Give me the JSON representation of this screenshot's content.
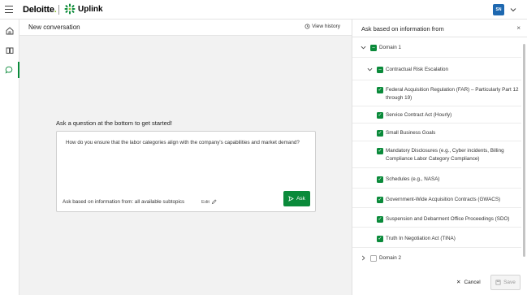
{
  "topbar": {
    "brand": "Deloitte",
    "brand_dot": ".",
    "product": "Uplink",
    "avatar_initials": "SN"
  },
  "rail": {
    "items": [
      {
        "icon": "home-icon"
      },
      {
        "icon": "book-icon"
      },
      {
        "icon": "chat-icon",
        "active": true
      }
    ]
  },
  "main": {
    "title": "New conversation",
    "view_history_label": "View history",
    "empty_prompt": "Ask a question at the bottom to get started!",
    "question": "How do you ensure that the labor categories align with the company's capabilities and market demand?",
    "ask_based_label": "Ask based on information from: all available subtopics",
    "edit_label": "Edit",
    "ask_button_label": "Ask"
  },
  "panel": {
    "title": "Ask based on information from",
    "domain1_label": "Domain 1",
    "subtopic_label": "Contractual Risk Escalation",
    "items": [
      "Federal Acquisition Regulation (FAR) – Particularly Part 12 through 19)",
      "Service Contract Act (Hourly)",
      "Small Business Goals",
      "Mandatory Disclosures (e.g., Cyber incidents, Billing Compliance Labor Category Compliance)",
      "Schedules (e.g., NASA)",
      "Government-Wide Acquisition Contracts (GWACS)",
      "Suspension and Debarment Office Proceedings (SDO)",
      "Truth In Negotiation Act (TINA)"
    ],
    "domain2_label": "Domain 2",
    "cancel_label": "Cancel",
    "save_label": "Save"
  },
  "colors": {
    "accent": "#0a8a3a",
    "avatar": "#1e68b0",
    "brand_dot": "#86bc25"
  }
}
